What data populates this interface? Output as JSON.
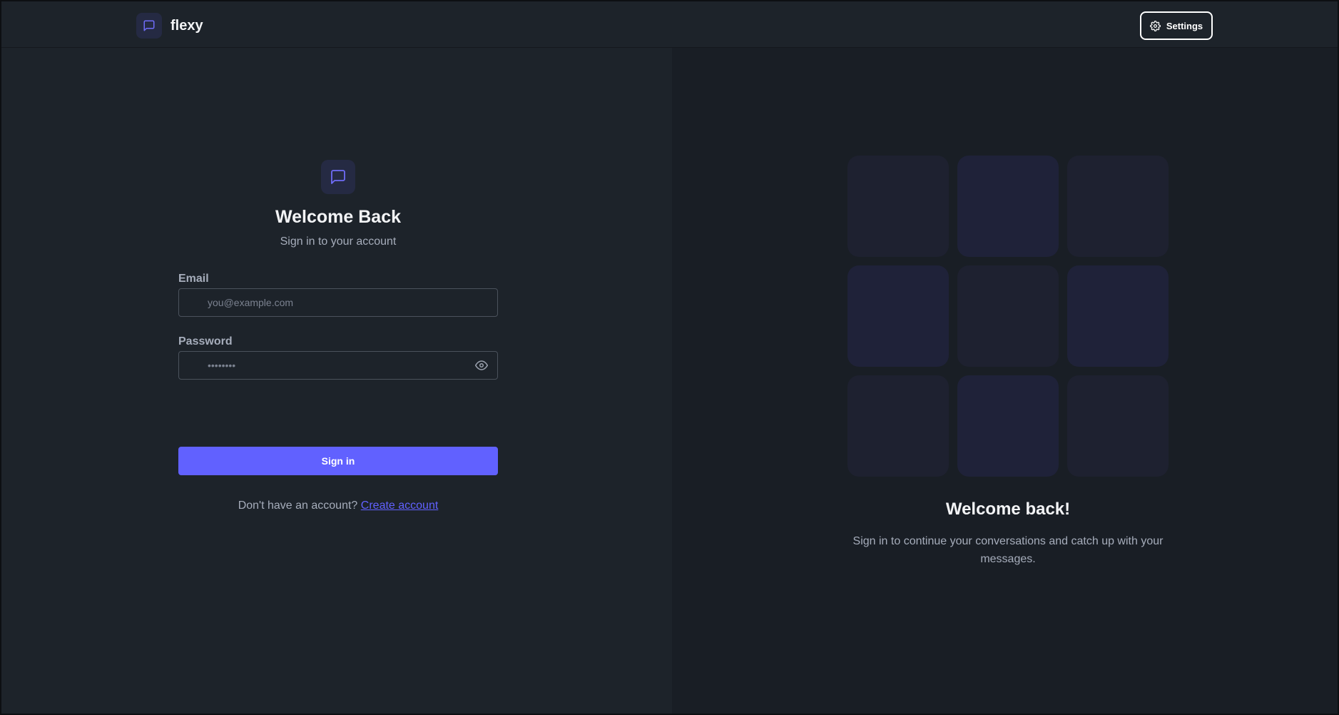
{
  "navbar": {
    "brand_name": "flexy",
    "brand_icon": "chat-bubble-icon",
    "settings_label": "Settings",
    "settings_icon": "gear-icon"
  },
  "login": {
    "icon": "chat-bubble-icon",
    "title": "Welcome Back",
    "subtitle": "Sign in to your account",
    "email": {
      "label": "Email",
      "placeholder": "you@example.com",
      "value": ""
    },
    "password": {
      "label": "Password",
      "placeholder": "••••••••",
      "value": "",
      "toggle_icon": "eye-icon"
    },
    "submit_label": "Sign in",
    "signup_prompt": "Don't have an account?",
    "signup_link": "Create account"
  },
  "promo": {
    "title": "Welcome back!",
    "text": "Sign in to continue your conversations and catch up with your messages."
  },
  "colors": {
    "accent": "#6161ff",
    "background": "#1d232a",
    "panel": "#191e25"
  }
}
